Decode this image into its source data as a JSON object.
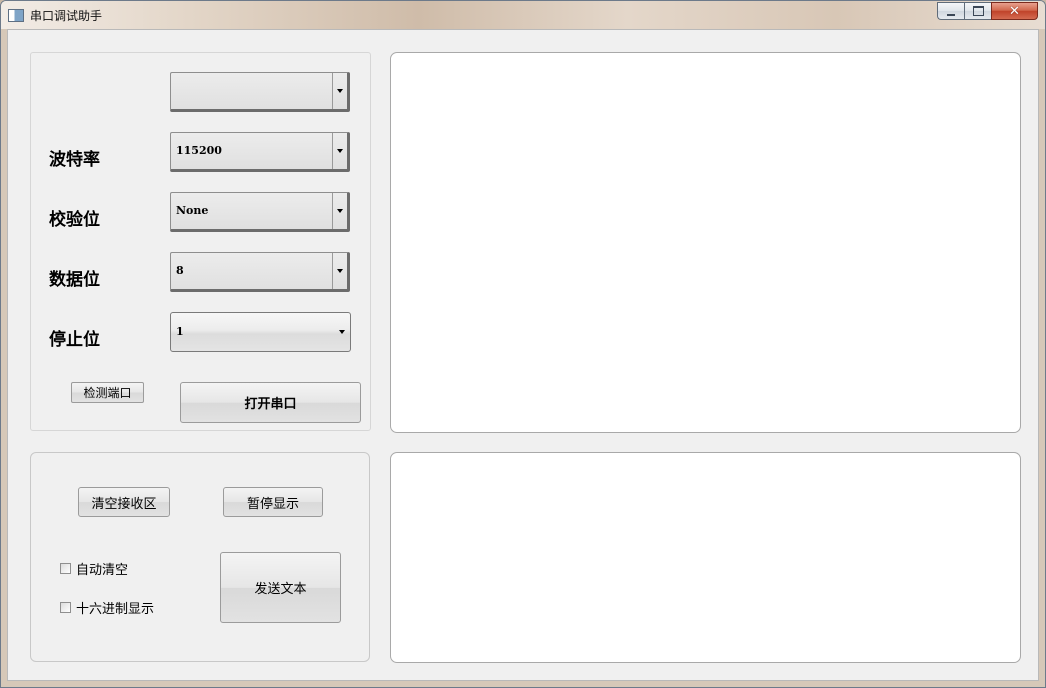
{
  "window": {
    "title": "串口调试助手"
  },
  "settings": {
    "port": {
      "label": "",
      "value": ""
    },
    "baud": {
      "label": "波特率",
      "value": "115200"
    },
    "parity": {
      "label": "校验位",
      "value": "None"
    },
    "databits": {
      "label": "数据位",
      "value": "8"
    },
    "stopbits": {
      "label": "停止位",
      "value": "1"
    },
    "detect_button": "检测端口",
    "open_button": "打开串口"
  },
  "controls": {
    "clear_button": "清空接收区",
    "pause_button": "暂停显示",
    "auto_clear_label": "自动清空",
    "hex_display_label": "十六进制显示",
    "send_button": "发送文本"
  },
  "receive_area": {
    "text": ""
  },
  "send_area": {
    "text": ""
  },
  "icons": {
    "app": "window-icon",
    "minimize": "minimize-icon",
    "maximize": "maximize-icon",
    "close": "close-icon",
    "dropdown": "chevron-down-icon"
  },
  "colors": {
    "close_button": "#c9452d",
    "client_bg": "#f0f0f0",
    "textarea_bg": "#ffffff"
  }
}
